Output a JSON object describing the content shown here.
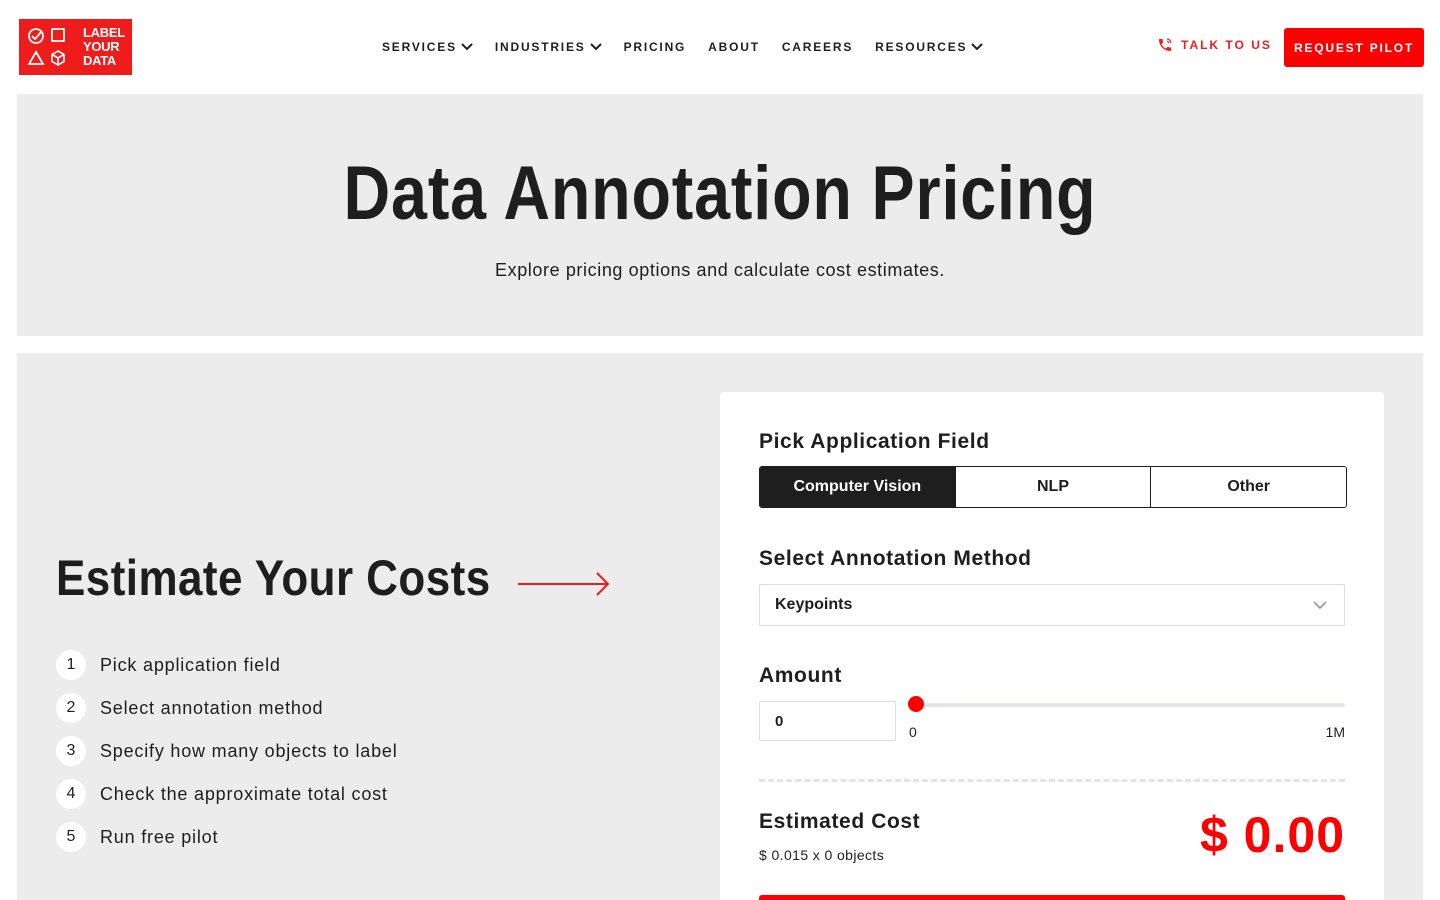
{
  "brand": {
    "logo_lines": [
      "LABEL",
      "YOUR",
      "DATA"
    ],
    "accent_color": "#ff0000",
    "logo_icons": [
      "checkmark-circle-icon",
      "square-icon",
      "triangle-icon",
      "cube-icon"
    ]
  },
  "nav": {
    "items": [
      {
        "label": "SERVICES",
        "has_dropdown": true
      },
      {
        "label": "INDUSTRIES",
        "has_dropdown": true
      },
      {
        "label": "PRICING",
        "has_dropdown": false
      },
      {
        "label": "ABOUT",
        "has_dropdown": false
      },
      {
        "label": "CAREERS",
        "has_dropdown": false
      },
      {
        "label": "RESOURCES",
        "has_dropdown": true
      }
    ],
    "talk_label": "TALK TO US",
    "talk_icon": "phone-icon",
    "cta_label": "REQUEST PILOT"
  },
  "hero": {
    "title": "Data Annotation Pricing",
    "subtitle": "Explore pricing options and calculate cost estimates."
  },
  "estimate": {
    "title": "Estimate Your Costs",
    "steps": [
      {
        "num": "1",
        "text": "Pick application field"
      },
      {
        "num": "2",
        "text": "Select annotation method"
      },
      {
        "num": "3",
        "text": "Specify how many objects to label"
      },
      {
        "num": "4",
        "text": "Check the approximate total cost"
      },
      {
        "num": "5",
        "text": "Run free pilot"
      }
    ]
  },
  "calculator": {
    "field_label": "Pick Application Field",
    "fields": [
      {
        "label": "Computer Vision",
        "active": true
      },
      {
        "label": "NLP",
        "active": false
      },
      {
        "label": "Other",
        "active": false
      }
    ],
    "method_label": "Select Annotation Method",
    "method_selected": "Keypoints",
    "amount_label": "Amount",
    "amount_value": "0",
    "slider": {
      "min_label": "0",
      "max_label": "1M",
      "level": 0
    },
    "cost_label": "Estimated Cost",
    "cost_formula": "$ 0.015 x 0 objects",
    "cost_value": "$ 0.00"
  }
}
